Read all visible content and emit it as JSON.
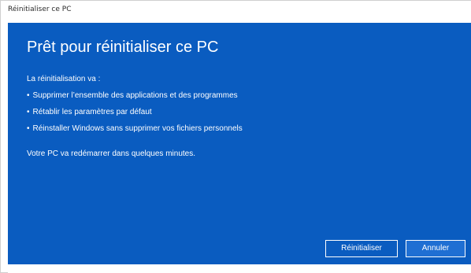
{
  "window": {
    "title": "Réinitialiser ce PC"
  },
  "dialog": {
    "heading": "Prêt pour réinitialiser ce PC",
    "intro": "La réinitialisation va :",
    "bullets": [
      "Supprimer l’ensemble des applications et des programmes",
      "Rétablir les paramètres par défaut",
      "Réinstaller Windows sans supprimer vos fichiers personnels"
    ],
    "note": "Votre PC va redémarrer dans quelques minutes."
  },
  "buttons": {
    "reset_label": "Réinitialiser",
    "cancel_label": "Annuler"
  },
  "colors": {
    "accent": "#0a5cc0",
    "text": "#ffffff"
  }
}
